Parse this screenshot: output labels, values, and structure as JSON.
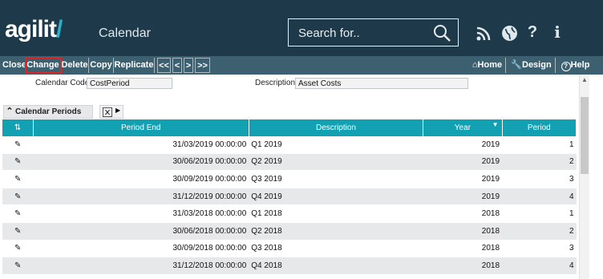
{
  "header": {
    "logo_text": "agilit",
    "logo_slash": "/",
    "app_title": "Calendar",
    "search_placeholder": "Search for..",
    "icons": [
      "rss-icon",
      "globe-icon",
      "help-question-icon",
      "info-icon"
    ]
  },
  "toolbar": {
    "close": "Close",
    "change": "Change",
    "delete": "Delete",
    "copy": "Copy",
    "replicate": "Replicate",
    "first": "<<",
    "prev": "<",
    "next": ">",
    "last": ">>",
    "home": "Home",
    "design": "Design",
    "help": "Help"
  },
  "form": {
    "calendar_code_label": "Calendar Code",
    "calendar_code_value": "CostPeriod",
    "description_label": "Description",
    "description_value": "Asset Costs"
  },
  "panel": {
    "title": "Calendar Periods"
  },
  "table": {
    "columns": [
      "Period End",
      "Description",
      "Year",
      "Period"
    ],
    "rows": [
      {
        "period_end": "31/03/2019 00:00:00",
        "description": "Q1 2019",
        "year": "2019",
        "period": "1"
      },
      {
        "period_end": "30/06/2019 00:00:00",
        "description": "Q2 2019",
        "year": "2019",
        "period": "2"
      },
      {
        "period_end": "30/09/2019 00:00:00",
        "description": "Q3 2019",
        "year": "2019",
        "period": "3"
      },
      {
        "period_end": "31/12/2019 00:00:00",
        "description": "Q4 2019",
        "year": "2019",
        "period": "4"
      },
      {
        "period_end": "31/03/2018 00:00:00",
        "description": "Q1 2018",
        "year": "2018",
        "period": "1"
      },
      {
        "period_end": "30/06/2018 00:00:00",
        "description": "Q2 2018",
        "year": "2018",
        "period": "2"
      },
      {
        "period_end": "30/09/2018 00:00:00",
        "description": "Q3 2018",
        "year": "2018",
        "period": "3"
      },
      {
        "period_end": "31/12/2018 00:00:00",
        "description": "Q4 2018",
        "year": "2018",
        "period": "4"
      }
    ]
  },
  "colors": {
    "header_bg": "#1e3a4a",
    "toolbar_bg": "#3d6070",
    "grid_header": "#12a1b3",
    "accent": "#2ab3c8",
    "highlight": "#e02424"
  }
}
